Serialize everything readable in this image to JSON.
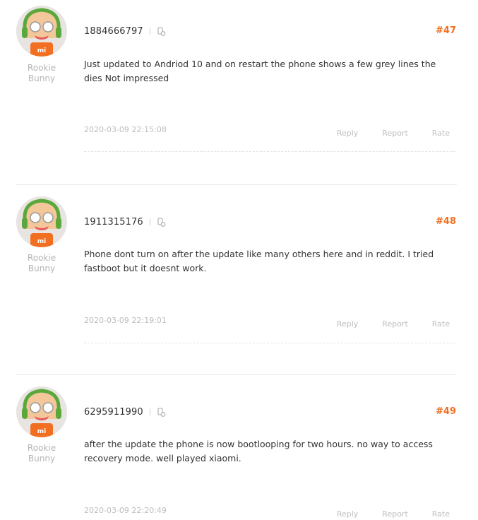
{
  "posts": [
    {
      "username": "1884666797",
      "floor": "#47",
      "rank": [
        "Rookie",
        "Bunny"
      ],
      "content": "Just updated to Andriod 10 and on restart the phone shows a few grey lines the dies Not impressed",
      "time": "2020-03-09 22:15:08",
      "actions": [
        "Reply",
        "Report",
        "Rate"
      ]
    },
    {
      "username": "1911315176",
      "floor": "#48",
      "rank": [
        "Rookie",
        "Bunny"
      ],
      "content": "Phone dont turn on after the update like many others here and in reddit. I tried fastboot but it doesnt work.",
      "time": "2020-03-09 22:19:01",
      "actions": [
        "Reply",
        "Report",
        "Rate"
      ]
    },
    {
      "username": "6295911990",
      "floor": "#49",
      "rank": [
        "Rookie",
        "Bunny"
      ],
      "content": "after the update the phone is now bootlooping for two hours. no way to access recovery mode. well played xiaomi.",
      "time": "2020-03-09 22:20:49",
      "actions": [
        "Reply",
        "Report",
        "Rate"
      ]
    }
  ],
  "avatar_logo": "mi",
  "colors": {
    "accent": "#f26f21",
    "muted": "#bdbdbd",
    "text": "#333333"
  },
  "icons": {
    "avatar": "mi-bunny-avatar",
    "device": "device-icon"
  }
}
